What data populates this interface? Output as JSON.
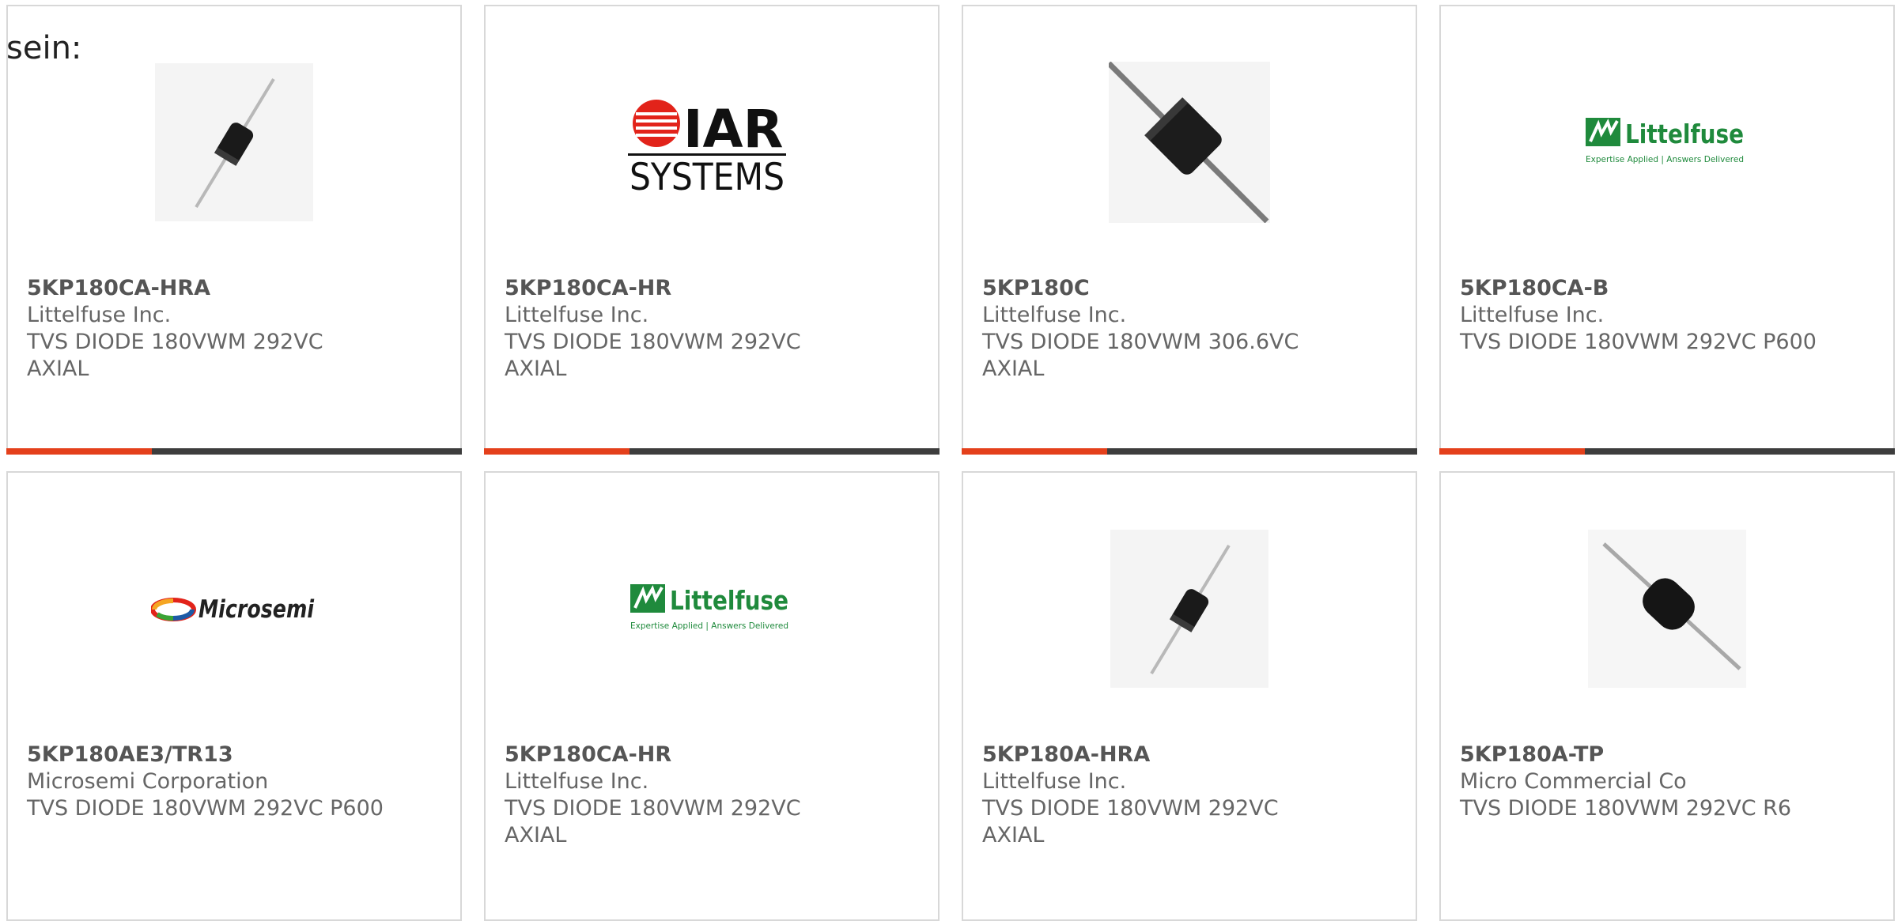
{
  "intro_text": "sein:",
  "colors": {
    "accent": "#e4401b",
    "bar": "#3d3d3d",
    "littelfuse_green": "#1f8a3c"
  },
  "products": [
    {
      "part": "5KP180CA-HRA",
      "maker": "Littelfuse Inc.",
      "desc_line1": "TVS DIODE 180VWM 292VC",
      "desc_line2": "AXIAL",
      "image": "axial-diode-small-icon"
    },
    {
      "part": "5KP180CA-HR",
      "maker": "Littelfuse Inc.",
      "desc_line1": "TVS DIODE 180VWM 292VC",
      "desc_line2": "AXIAL",
      "image": "iar-systems-logo",
      "logo_word1": "IAR",
      "logo_word2": "SYSTEMS"
    },
    {
      "part": "5KP180C",
      "maker": "Littelfuse Inc.",
      "desc_line1": "TVS DIODE 180VWM 306.6VC",
      "desc_line2": "AXIAL",
      "image": "axial-diode-large-icon"
    },
    {
      "part": "5KP180CA-B",
      "maker": "Littelfuse Inc.",
      "desc_line1": "TVS DIODE 180VWM 292VC P600",
      "desc_line2": "",
      "image": "littelfuse-logo",
      "logo_word1": "Littelfuse",
      "logo_tagline": "Expertise Applied | Answers Delivered"
    },
    {
      "part": "5KP180AE3/TR13",
      "maker": "Microsemi Corporation",
      "desc_line1": "TVS DIODE 180VWM 292VC P600",
      "desc_line2": "",
      "image": "microsemi-logo",
      "logo_word1": "Microsemi"
    },
    {
      "part": "5KP180CA-HR",
      "maker": "Littelfuse Inc.",
      "desc_line1": "TVS DIODE 180VWM 292VC",
      "desc_line2": "AXIAL",
      "image": "littelfuse-logo",
      "logo_word1": "Littelfuse",
      "logo_tagline": "Expertise Applied | Answers Delivered"
    },
    {
      "part": "5KP180A-HRA",
      "maker": "Littelfuse Inc.",
      "desc_line1": "TVS DIODE 180VWM 292VC",
      "desc_line2": "AXIAL",
      "image": "axial-diode-small-icon"
    },
    {
      "part": "5KP180A-TP",
      "maker": "Micro Commercial Co",
      "desc_line1": "TVS DIODE 180VWM 292VC R6",
      "desc_line2": "",
      "image": "axial-diode-tilted-icon"
    }
  ]
}
